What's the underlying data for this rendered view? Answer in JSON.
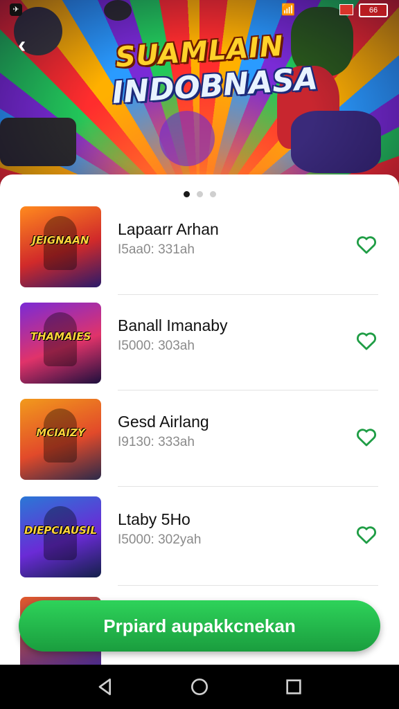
{
  "status": {
    "left_icon": "app-badge-icon",
    "wifi_icon": "wifi-icon",
    "battery": "66"
  },
  "header": {
    "title_line1": "SUAMLAIN",
    "title_line2": "INDOBNASA",
    "back_icon": "back-arrow-icon"
  },
  "carousel": {
    "count": 3,
    "active": 0
  },
  "games": [
    {
      "thumb_text": "JEIGNAAN",
      "thumb_colors": [
        "#ff8a1e",
        "#d12a2a",
        "#2a1a6a"
      ],
      "title": "Lapaarr Arhan",
      "subtitle": "I5aa0: 331ah"
    },
    {
      "thumb_text": "THAMAIES",
      "thumb_colors": [
        "#7a2bd6",
        "#e0336a",
        "#1d0f3d"
      ],
      "title": "Banall Imanaby",
      "subtitle": "I5000: 303ah"
    },
    {
      "thumb_text": "MCIAIZY",
      "thumb_colors": [
        "#f29a1c",
        "#e24a2a",
        "#2b2a4a"
      ],
      "title": "Gesd Airlang",
      "subtitle": "I9130: 333ah"
    },
    {
      "thumb_text": "DIEPCIAUSIL",
      "thumb_colors": [
        "#2a78d6",
        "#6a2bd6",
        "#14204a"
      ],
      "title": "Ltaby 5Ho",
      "subtitle": "I5000: 302yah"
    }
  ],
  "cta": {
    "label": "Prpiard aupakkcnekan"
  },
  "colors": {
    "accent": "#22b24c",
    "heart": "#1f9d45"
  },
  "navbar": {
    "back_icon": "nav-back-icon",
    "home_icon": "nav-home-icon",
    "recents_icon": "nav-recents-icon"
  }
}
